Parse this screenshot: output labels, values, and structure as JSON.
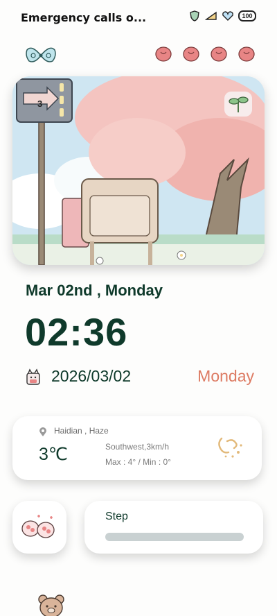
{
  "status_bar": {
    "notification_text": "Emergency calls o...",
    "battery_level": "100",
    "icons": [
      "shield-icon",
      "signal-icon",
      "wifi-heart-icon",
      "battery-icon"
    ]
  },
  "decor": {
    "left_icon": "butterfly-bow-icon",
    "hearts": [
      "heart-icon",
      "heart-icon",
      "heart-icon",
      "heart-icon"
    ],
    "heart_color": "#e88585"
  },
  "hero": {
    "sign_number": "3",
    "icon": "sprout-icon"
  },
  "clock": {
    "date_line": "Mar 02nd , Monday",
    "time": "02:36",
    "date_numeric": "2026/03/02",
    "weekday": "Monday",
    "accent_color": "#dd7b63",
    "text_color": "#0f3a2b"
  },
  "weather": {
    "location": "Haidian , Haze",
    "temperature": "3℃",
    "wind": "Southwest,3km/h",
    "range": "Max : 4° / Min : 0°",
    "icon": "haze-icon"
  },
  "steps": {
    "label": "Step",
    "progress": 0
  },
  "bottom": {
    "icon": "bear-icon"
  }
}
